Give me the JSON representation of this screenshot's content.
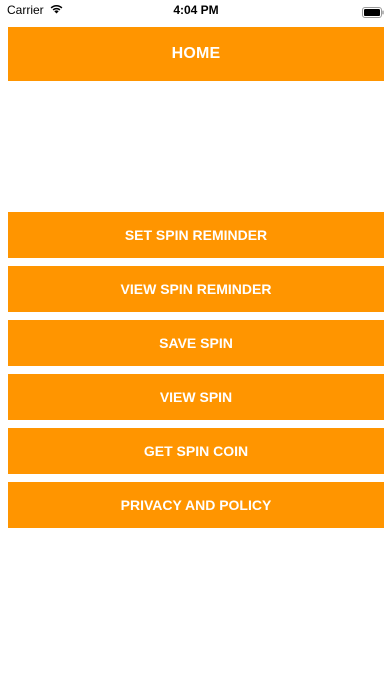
{
  "status_bar": {
    "carrier": "Carrier",
    "time": "4:04 PM",
    "wifi_icon": "wifi-icon",
    "battery_icon": "battery-icon"
  },
  "header": {
    "title": "HOME",
    "color": "#ff9500"
  },
  "menu": {
    "items": [
      {
        "label": "SET SPIN REMINDER"
      },
      {
        "label": "VIEW SPIN REMINDER"
      },
      {
        "label": "SAVE SPIN"
      },
      {
        "label": "VIEW SPIN"
      },
      {
        "label": "GET SPIN COIN"
      },
      {
        "label": "PRIVACY AND POLICY"
      }
    ]
  }
}
